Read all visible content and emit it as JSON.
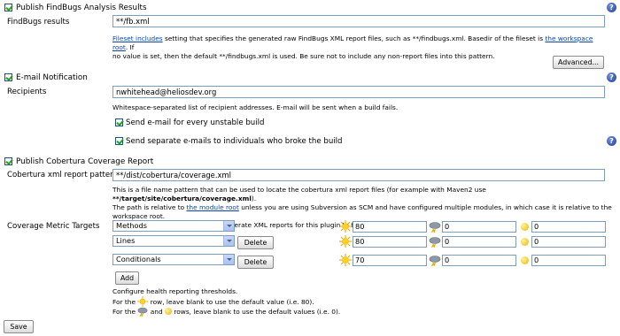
{
  "findbugs": {
    "title": "Publish FindBugs Analysis Results",
    "results_label": "FindBugs results",
    "results_value": "**/fb.xml",
    "help_link1": "Fileset includes",
    "help_text1": " setting that specifies the generated raw FindBugs XML report files, such as **/findbugs.xml. Basedir of the fileset is ",
    "help_link2": "the workspace root",
    "help_text2": ". If",
    "help_line2": "no value is set, then the default **/findbugs.xml is used. Be sure not to include any non-report files into this pattern.",
    "advanced_label": "Advanced..."
  },
  "email": {
    "title": "E-mail Notification",
    "recipients_label": "Recipients",
    "recipients_value": "nwhitehead@heliosdev.org",
    "help": "Whitespace-separated list of recipient addresses. E-mail will be sent when a build fails.",
    "unstable_label": "Send e-mail for every unstable build",
    "separate_label": "Send separate e-mails to individuals who broke the build"
  },
  "cobertura": {
    "title": "Publish Cobertura Coverage Report",
    "pattern_label": "Cobertura xml report pattern",
    "pattern_value": "**/dist/cobertura/coverage.xml",
    "help1a": "This is a file name pattern that can be used to locate the cobertura xml report files (for example with Maven2 use ",
    "help1b": "**/target/site/cobertura/coverage.xml",
    "help1c": ").",
    "help2a": "The path is relative to ",
    "help2link": "the module root",
    "help2b": " unless you are using Subversion as SCM and have configured multiple modules, in which case it is relative to the",
    "help3": "workspace root.",
    "help4": "Cobertura must be configured to generate XML reports for this plugin to function.",
    "metric_label": "Coverage Metric Targets",
    "delete_label": "Delete",
    "add_label": "Add",
    "metrics": [
      {
        "name": "Methods",
        "sunny": "80",
        "stormy": "0",
        "unstable": "0"
      },
      {
        "name": "Lines",
        "sunny": "80",
        "stormy": "0",
        "unstable": "0"
      },
      {
        "name": "Conditionals",
        "sunny": "70",
        "stormy": "0",
        "unstable": "0"
      }
    ],
    "thresh_title": "Configure health reporting thresholds.",
    "thresh1a": "For the",
    "thresh1b": "row, leave blank to use the default value (i.e. 80).",
    "thresh2a": "For the",
    "thresh2b": "and",
    "thresh2c": "rows, leave blank to use the default values (i.e. 0)."
  },
  "save_label": "Save"
}
